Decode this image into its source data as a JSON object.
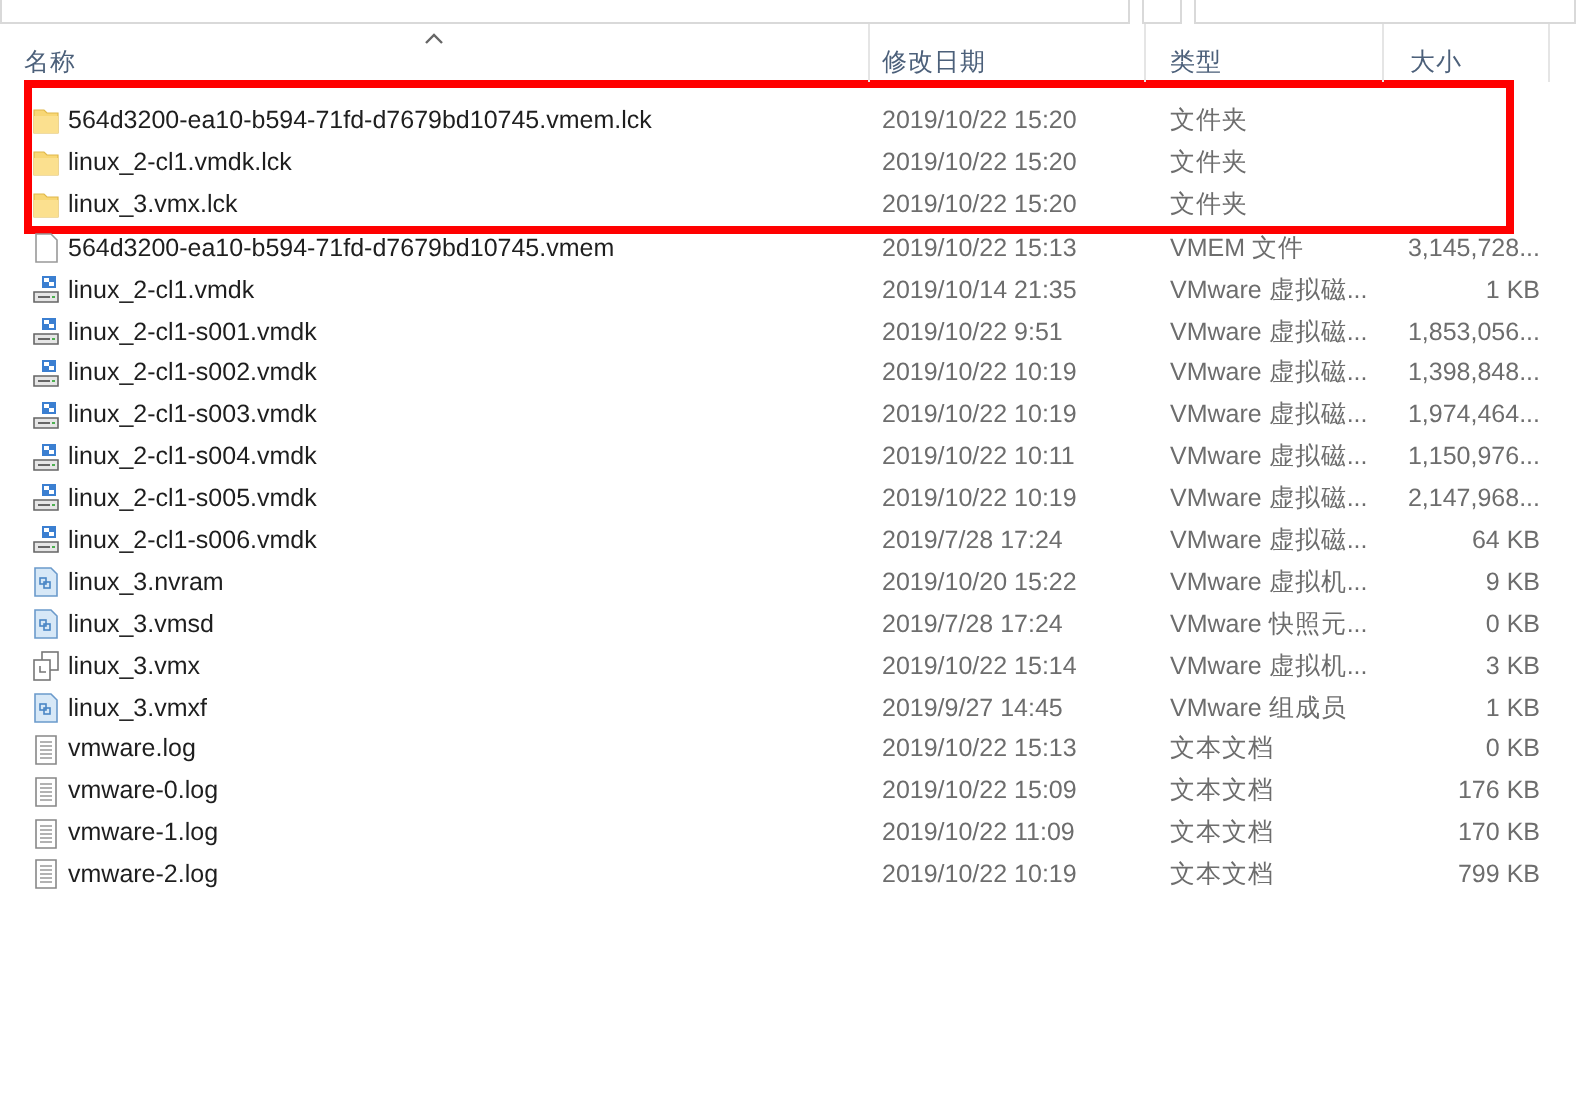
{
  "columns": [
    {
      "label": "名称",
      "sorted": true
    },
    {
      "label": "修改日期",
      "sorted": false
    },
    {
      "label": "类型",
      "sorted": false
    },
    {
      "label": "大小",
      "sorted": false
    }
  ],
  "rows": [
    {
      "kind": "folder",
      "name": "564d3200-ea10-b594-71fd-d7679bd10745.vmem.lck",
      "modified": "2019/10/22 15:20",
      "type": "文件夹",
      "size": "",
      "highlighted": true
    },
    {
      "kind": "folder",
      "name": "linux_2-cl1.vmdk.lck",
      "modified": "2019/10/22 15:20",
      "type": "文件夹",
      "size": "",
      "highlighted": true
    },
    {
      "kind": "folder",
      "name": "linux_3.vmx.lck",
      "modified": "2019/10/22 15:20",
      "type": "文件夹",
      "size": "",
      "highlighted": true
    },
    {
      "kind": "blank",
      "name": "564d3200-ea10-b594-71fd-d7679bd10745.vmem",
      "modified": "2019/10/22 15:13",
      "type": "VMEM 文件",
      "size": "3,145,728...",
      "highlighted": false
    },
    {
      "kind": "disk",
      "name": "linux_2-cl1.vmdk",
      "modified": "2019/10/14 21:35",
      "type": "VMware 虚拟磁...",
      "size": "1 KB",
      "highlighted": false
    },
    {
      "kind": "disk",
      "name": "linux_2-cl1-s001.vmdk",
      "modified": "2019/10/22 9:51",
      "type": "VMware 虚拟磁...",
      "size": "1,853,056...",
      "highlighted": false
    },
    {
      "kind": "disk",
      "name": "linux_2-cl1-s002.vmdk",
      "modified": "2019/10/22 10:19",
      "type": "VMware 虚拟磁...",
      "size": "1,398,848...",
      "highlighted": false
    },
    {
      "kind": "disk",
      "name": "linux_2-cl1-s003.vmdk",
      "modified": "2019/10/22 10:19",
      "type": "VMware 虚拟磁...",
      "size": "1,974,464...",
      "highlighted": false
    },
    {
      "kind": "disk",
      "name": "linux_2-cl1-s004.vmdk",
      "modified": "2019/10/22 10:11",
      "type": "VMware 虚拟磁...",
      "size": "1,150,976...",
      "highlighted": false
    },
    {
      "kind": "disk",
      "name": "linux_2-cl1-s005.vmdk",
      "modified": "2019/10/22 10:19",
      "type": "VMware 虚拟磁...",
      "size": "2,147,968...",
      "highlighted": false
    },
    {
      "kind": "disk",
      "name": "linux_2-cl1-s006.vmdk",
      "modified": "2019/7/28 17:24",
      "type": "VMware 虚拟磁...",
      "size": "64 KB",
      "highlighted": false
    },
    {
      "kind": "vmfile",
      "name": "linux_3.nvram",
      "modified": "2019/10/20 15:22",
      "type": "VMware 虚拟机...",
      "size": "9 KB",
      "highlighted": false
    },
    {
      "kind": "vmfile",
      "name": "linux_3.vmsd",
      "modified": "2019/7/28 17:24",
      "type": "VMware 快照元...",
      "size": "0 KB",
      "highlighted": false
    },
    {
      "kind": "vmx",
      "name": "linux_3.vmx",
      "modified": "2019/10/22 15:14",
      "type": "VMware 虚拟机...",
      "size": "3 KB",
      "highlighted": false
    },
    {
      "kind": "vmfile",
      "name": "linux_3.vmxf",
      "modified": "2019/9/27 14:45",
      "type": "VMware 组成员",
      "size": "1 KB",
      "highlighted": false
    },
    {
      "kind": "text",
      "name": "vmware.log",
      "modified": "2019/10/22 15:13",
      "type": "文本文档",
      "size": "0 KB",
      "highlighted": false
    },
    {
      "kind": "text",
      "name": "vmware-0.log",
      "modified": "2019/10/22 15:09",
      "type": "文本文档",
      "size": "176 KB",
      "highlighted": false
    },
    {
      "kind": "text",
      "name": "vmware-1.log",
      "modified": "2019/10/22 11:09",
      "type": "文本文档",
      "size": "170 KB",
      "highlighted": false
    },
    {
      "kind": "text",
      "name": "vmware-2.log",
      "modified": "2019/10/22 10:19",
      "type": "文本文档",
      "size": "799 KB",
      "highlighted": false
    }
  ]
}
